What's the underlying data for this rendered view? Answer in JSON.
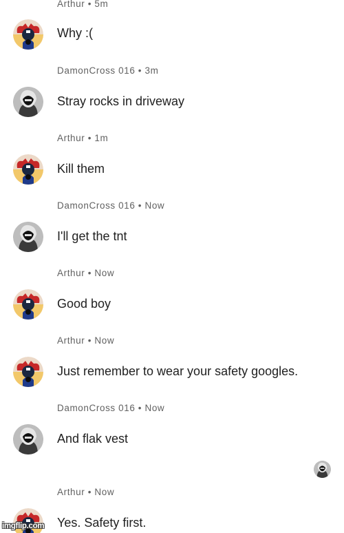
{
  "messages": [
    {
      "author": "Arthur",
      "time": "5m",
      "meta": "Arthur • 5m",
      "text": "Why  :(",
      "avatar": "arthur-avatar"
    },
    {
      "author": "DamonCross 016",
      "time": "3m",
      "meta": "DamonCross 016 • 3m",
      "text": "Stray rocks in driveway",
      "avatar": "damon-avatar"
    },
    {
      "author": "Arthur",
      "time": "1m",
      "meta": "Arthur • 1m",
      "text": "Kill them",
      "avatar": "arthur-avatar"
    },
    {
      "author": "DamonCross 016",
      "time": "Now",
      "meta": "DamonCross 016 • Now",
      "text": "I'll get the tnt",
      "avatar": "damon-avatar"
    },
    {
      "author": "Arthur",
      "time": "Now",
      "meta": "Arthur • Now",
      "text": "Good boy",
      "avatar": "arthur-avatar"
    },
    {
      "author": "Arthur",
      "time": "Now",
      "meta": "Arthur • Now",
      "text": "Just remember to wear your safety googles.",
      "avatar": "arthur-avatar"
    },
    {
      "author": "DamonCross 016",
      "time": "Now",
      "meta": "DamonCross 016 • Now",
      "text": "And flak vest",
      "avatar": "damon-avatar"
    },
    {
      "author": "Arthur",
      "time": "Now",
      "meta": "Arthur • Now",
      "text": "Yes. Safety first.",
      "avatar": "arthur-avatar"
    }
  ],
  "read_receipt": {
    "avatar": "damon-avatar"
  },
  "watermark": "imgflip.com",
  "colors": {
    "meta": "#616161",
    "text": "#212121",
    "background": "#ffffff"
  }
}
